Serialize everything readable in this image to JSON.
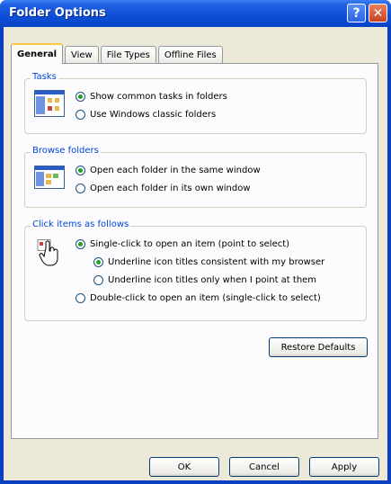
{
  "window": {
    "title": "Folder Options"
  },
  "titlebar": {
    "help_glyph": "?",
    "close_glyph": "✕"
  },
  "tabs": [
    {
      "label": "General"
    },
    {
      "label": "View"
    },
    {
      "label": "File Types"
    },
    {
      "label": "Offline Files"
    }
  ],
  "active_tab": "General",
  "tasks": {
    "label": "Tasks",
    "options": [
      {
        "label": "Show common tasks in folders",
        "checked": true
      },
      {
        "label": "Use Windows classic folders",
        "checked": false
      }
    ]
  },
  "browse": {
    "label": "Browse folders",
    "options": [
      {
        "label": "Open each folder in the same window",
        "checked": true
      },
      {
        "label": "Open each folder in its own window",
        "checked": false
      }
    ]
  },
  "click": {
    "label": "Click items as follows",
    "options": [
      {
        "label": "Single-click to open an item (point to select)",
        "checked": true
      },
      {
        "label": "Underline icon titles consistent with my browser",
        "checked": true
      },
      {
        "label": "Underline icon titles only when I point at them",
        "checked": false
      },
      {
        "label": "Double-click to open an item (single-click to select)",
        "checked": false
      }
    ]
  },
  "buttons": {
    "restore": "Restore Defaults",
    "ok": "OK",
    "cancel": "Cancel",
    "apply": "Apply"
  },
  "colors": {
    "accent": "#0046d5",
    "title_blue": "#0d4ed8",
    "radio_dot": "#21a121"
  }
}
